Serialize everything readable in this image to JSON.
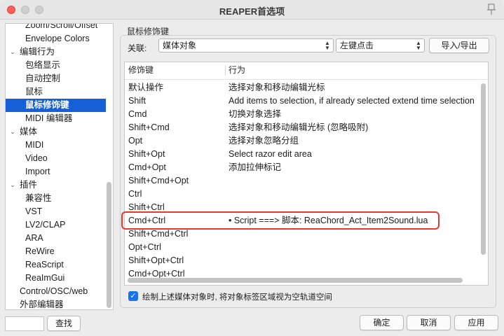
{
  "window": {
    "title": "REAPER首选项"
  },
  "sidebar": {
    "items": [
      {
        "label": "Zoom/Scroll/Offset",
        "arrow": ""
      },
      {
        "label": "Envelope Colors",
        "arrow": ""
      },
      {
        "label": "编辑行为",
        "arrow": "⌄"
      },
      {
        "label": "包络显示",
        "arrow": ""
      },
      {
        "label": "自动控制",
        "arrow": ""
      },
      {
        "label": "鼠标",
        "arrow": ""
      },
      {
        "label": "鼠标修饰键",
        "arrow": ""
      },
      {
        "label": "MIDI 编辑器",
        "arrow": ""
      },
      {
        "label": "媒体",
        "arrow": "⌄"
      },
      {
        "label": "MIDI",
        "arrow": ""
      },
      {
        "label": "Video",
        "arrow": ""
      },
      {
        "label": "Import",
        "arrow": ""
      },
      {
        "label": "插件",
        "arrow": "⌄"
      },
      {
        "label": "兼容性",
        "arrow": ""
      },
      {
        "label": "VST",
        "arrow": ""
      },
      {
        "label": "LV2/CLAP",
        "arrow": ""
      },
      {
        "label": "ARA",
        "arrow": ""
      },
      {
        "label": "ReWire",
        "arrow": ""
      },
      {
        "label": "ReaScript",
        "arrow": ""
      },
      {
        "label": "ReaImGui",
        "arrow": ""
      },
      {
        "label": "Control/OSC/web",
        "arrow": ""
      },
      {
        "label": "外部编辑器",
        "arrow": ""
      }
    ],
    "selected": "鼠标修饰键",
    "search_value": "",
    "find_button": "查找"
  },
  "panel": {
    "section_title": "鼠标修饰键",
    "context_label": "关联:",
    "context_value": "媒体对象",
    "action_value": "左键点击",
    "import_export_button": "导入/导出",
    "columns": {
      "modifier": "修饰键",
      "action": "行为"
    },
    "rows": [
      {
        "modifier": "默认操作",
        "action": "选择对象和移动编辑光标"
      },
      {
        "modifier": "Shift",
        "action": "Add items to selection, if already selected extend time selection"
      },
      {
        "modifier": "Cmd",
        "action": "切换对象选择"
      },
      {
        "modifier": "Shift+Cmd",
        "action": "选择对象和移动编辑光标 (忽略吸附)"
      },
      {
        "modifier": "Opt",
        "action": "选择对象忽略分组"
      },
      {
        "modifier": "Shift+Opt",
        "action": "Select razor edit area"
      },
      {
        "modifier": "Cmd+Opt",
        "action": "添加拉伸标记"
      },
      {
        "modifier": "Shift+Cmd+Opt",
        "action": ""
      },
      {
        "modifier": "Ctrl",
        "action": ""
      },
      {
        "modifier": "Shift+Ctrl",
        "action": ""
      },
      {
        "modifier": "Cmd+Ctrl",
        "action": "• Script ===> 脚本: ReaChord_Act_Item2Sound.lua"
      },
      {
        "modifier": "Shift+Cmd+Ctrl",
        "action": ""
      },
      {
        "modifier": "Opt+Ctrl",
        "action": ""
      },
      {
        "modifier": "Shift+Opt+Ctrl",
        "action": ""
      },
      {
        "modifier": "Cmd+Opt+Ctrl",
        "action": ""
      }
    ],
    "checkbox_checked": true,
    "checkbox_label": "绘制上述媒体对象时, 将对象标签区域视为空轨道空间"
  },
  "footer": {
    "ok_button": "确定",
    "cancel_button": "取消",
    "apply_button": "应用"
  },
  "colors": {
    "selection": "#1560d6",
    "highlight_box": "#e23a2d",
    "checkbox": "#1a73e8"
  },
  "icons": [
    "pin-icon",
    "chevron-down-icon",
    "up-down-arrows-icon",
    "checkmark-icon"
  ]
}
